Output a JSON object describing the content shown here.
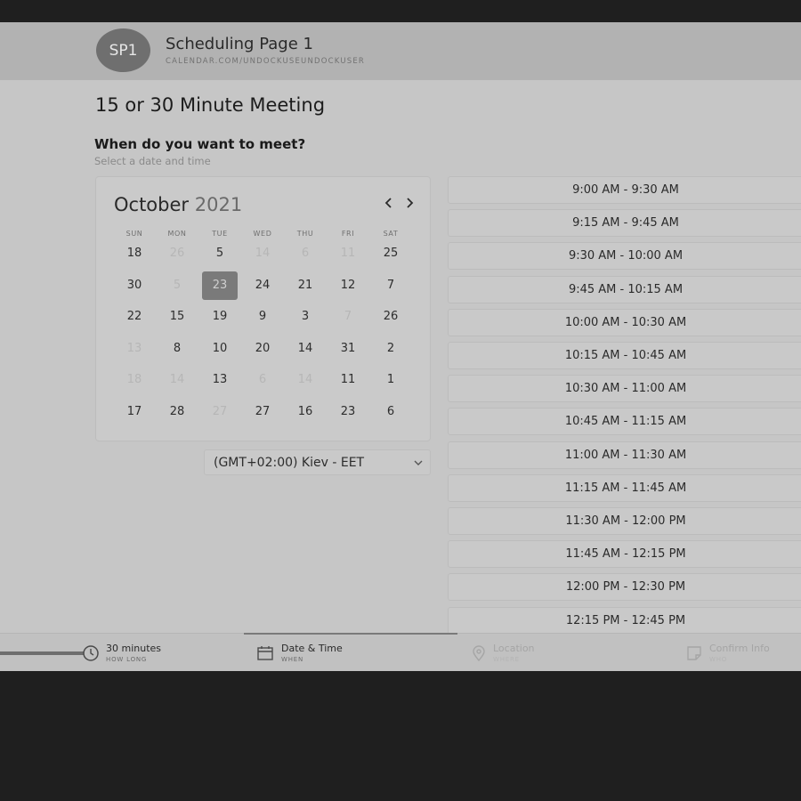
{
  "header": {
    "avatar_initials": "SP1",
    "page_name": "Scheduling Page 1",
    "page_url": "CALENDAR.COM/UNDOCKUSEUNDOCKUSER"
  },
  "meeting": {
    "title": "15 or 30 Minute Meeting",
    "question": "When do you want to meet?",
    "hint": "Select a date and time"
  },
  "calendar": {
    "month": "October",
    "year": "2021",
    "prev_icon": "chevron-left-icon",
    "next_icon": "chevron-right-icon",
    "weekdays": [
      "SUN",
      "MON",
      "TUE",
      "WED",
      "THU",
      "FRI",
      "SAT"
    ],
    "weeks": [
      [
        {
          "d": "18"
        },
        {
          "d": "26",
          "muted": true
        },
        {
          "d": "5"
        },
        {
          "d": "14",
          "muted": true
        },
        {
          "d": "6",
          "muted": true
        },
        {
          "d": "11",
          "muted": true
        },
        {
          "d": "25"
        }
      ],
      [
        {
          "d": "30"
        },
        {
          "d": "5",
          "muted": true
        },
        {
          "d": "23",
          "selected": true
        },
        {
          "d": "24"
        },
        {
          "d": "21"
        },
        {
          "d": "12"
        },
        {
          "d": "7"
        }
      ],
      [
        {
          "d": "22"
        },
        {
          "d": "15"
        },
        {
          "d": "19"
        },
        {
          "d": "9"
        },
        {
          "d": "3"
        },
        {
          "d": "7",
          "muted": true
        },
        {
          "d": "26"
        }
      ],
      [
        {
          "d": "13",
          "muted": true
        },
        {
          "d": "8"
        },
        {
          "d": "10"
        },
        {
          "d": "20"
        },
        {
          "d": "14"
        },
        {
          "d": "31"
        },
        {
          "d": "2"
        }
      ],
      [
        {
          "d": "18",
          "muted": true
        },
        {
          "d": "14",
          "muted": true
        },
        {
          "d": "13"
        },
        {
          "d": "6",
          "muted": true
        },
        {
          "d": "14",
          "muted": true
        },
        {
          "d": "11"
        },
        {
          "d": "1"
        }
      ],
      [
        {
          "d": "17"
        },
        {
          "d": "28"
        },
        {
          "d": "27",
          "muted": true
        },
        {
          "d": "27"
        },
        {
          "d": "16"
        },
        {
          "d": "23"
        },
        {
          "d": "6"
        }
      ]
    ]
  },
  "timezone": {
    "value": "(GMT+02:00) Kiev - EET",
    "icon": "chevron-down-icon"
  },
  "slots": [
    "9:00 AM - 9:30 AM",
    "9:15 AM - 9:45 AM",
    "9:30 AM - 10:00 AM",
    "9:45 AM - 10:15 AM",
    "10:00 AM - 10:30 AM",
    "10:15 AM - 10:45 AM",
    "10:30 AM - 11:00 AM",
    "10:45 AM - 11:15 AM",
    "11:00 AM - 11:30 AM",
    "11:15 AM - 11:45 AM",
    "11:30 AM - 12:00 PM",
    "11:45 AM - 12:15 PM",
    "12:00 PM - 12:30 PM",
    "12:15 PM - 12:45 PM"
  ],
  "footer": {
    "steps": [
      {
        "title": "30 minutes",
        "sub": "HOW LONG",
        "icon": "clock-icon",
        "state": "done"
      },
      {
        "title": "Date & Time",
        "sub": "WHEN",
        "icon": "calendar-icon",
        "state": "active"
      },
      {
        "title": "Location",
        "sub": "WHERE",
        "icon": "map-pin-icon",
        "state": "pending"
      },
      {
        "title": "Confirm Info",
        "sub": "WHO",
        "icon": "note-icon",
        "state": "pending"
      }
    ]
  }
}
